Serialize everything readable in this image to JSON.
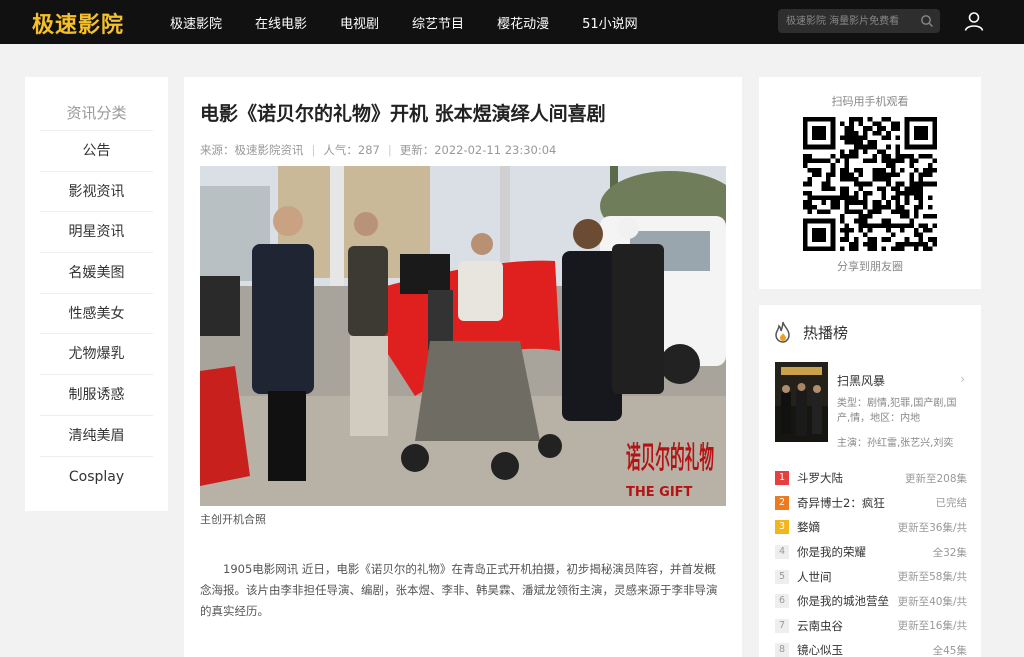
{
  "header": {
    "logo": "极速影院",
    "nav": [
      "极速影院",
      "在线电影",
      "电视剧",
      "综艺节目",
      "樱花动漫",
      "51小说网"
    ],
    "search_placeholder": "极速影院 海量影片免费看"
  },
  "sidebar": {
    "title": "资讯分类",
    "items": [
      "公告",
      "影视资讯",
      "明星资讯",
      "名媛美图",
      "性感美女",
      "尤物爆乳",
      "制服诱惑",
      "清纯美眉",
      "Cosplay"
    ]
  },
  "article": {
    "title": "电影《诺贝尔的礼物》开机 张本煜演绎人间喜剧",
    "source": "来源：极速影院资讯",
    "views": "人气：287",
    "updated": "更新：2022-02-11 23:30:04",
    "photo_text": "诺贝尔的礼物",
    "photo_subtext": "THE GIFT",
    "caption": "主创开机合照",
    "body": "1905电影网讯 近日，电影《诺贝尔的礼物》在青岛正式开机拍摄，初步揭秘演员阵容，并首发概念海报。该片由李非担任导演、编剧，张本煜、李非、韩昊霖、潘斌龙领衔主演，灵感来源于李非导演的真实经历。"
  },
  "qr": {
    "title": "扫码用手机观看",
    "footer": "分享到朋友圈"
  },
  "hot": {
    "title": "热播榜",
    "featured": {
      "name": "扫黑风暴",
      "chevron": "›",
      "genre": "类型：剧情,犯罪,国产剧,国产,情，地区：内地",
      "cast": "主演：孙红雷,张艺兴,刘奕"
    },
    "ranks": [
      {
        "num": "1",
        "name": "斗罗大陆",
        "status": "更新至208集"
      },
      {
        "num": "2",
        "name": "奇异博士2：疯狂",
        "status": "已完结"
      },
      {
        "num": "3",
        "name": "婺嫡",
        "status": "更新至36集/共"
      },
      {
        "num": "4",
        "name": "你是我的荣耀",
        "status": "全32集"
      },
      {
        "num": "5",
        "name": "人世间",
        "status": "更新至58集/共"
      },
      {
        "num": "6",
        "name": "你是我的城池营垒",
        "status": "更新至40集/共"
      },
      {
        "num": "7",
        "name": "云南虫谷",
        "status": "更新至16集/共"
      },
      {
        "num": "8",
        "name": "镜心似玉",
        "status": "全45集"
      }
    ]
  }
}
